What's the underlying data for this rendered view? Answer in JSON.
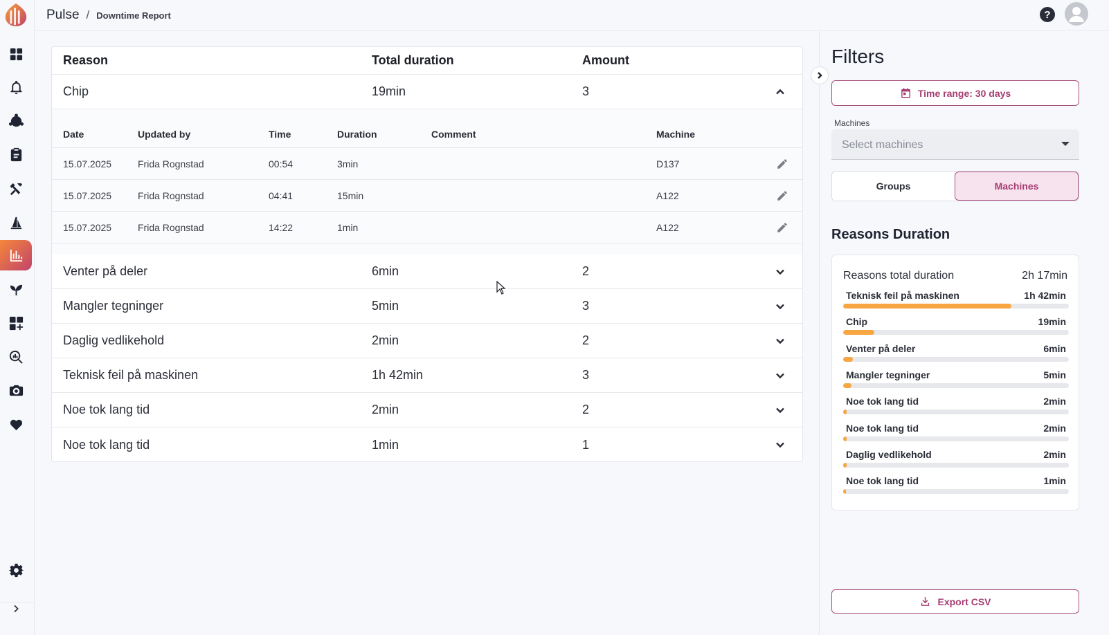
{
  "app": {
    "name": "Pulse",
    "separator": "/",
    "page": "Downtime Report"
  },
  "nav": [
    {
      "icon": "dashboard-icon"
    },
    {
      "icon": "bell-icon"
    },
    {
      "icon": "network-icon"
    },
    {
      "icon": "clipboard-icon"
    },
    {
      "icon": "tools-icon"
    },
    {
      "icon": "flask-icon"
    },
    {
      "icon": "downtime-chart-icon"
    },
    {
      "icon": "sprout-icon"
    },
    {
      "icon": "add-widget-icon"
    },
    {
      "icon": "analytics-search-icon"
    },
    {
      "icon": "camera-icon"
    },
    {
      "icon": "heartbeat-icon"
    }
  ],
  "table": {
    "headers": {
      "reason": "Reason",
      "total": "Total duration",
      "amount": "Amount"
    },
    "expanded": {
      "reason": "Chip",
      "total": "19min",
      "amount": "3",
      "sub_headers": {
        "date": "Date",
        "updated_by": "Updated by",
        "time": "Time",
        "duration": "Duration",
        "comment": "Comment",
        "machine": "Machine"
      },
      "rows": [
        {
          "date": "15.07.2025",
          "updated_by": "Frida Rognstad",
          "time": "00:54",
          "duration": "3min",
          "comment": "",
          "machine": "D137"
        },
        {
          "date": "15.07.2025",
          "updated_by": "Frida Rognstad",
          "time": "04:41",
          "duration": "15min",
          "comment": "",
          "machine": "A122"
        },
        {
          "date": "15.07.2025",
          "updated_by": "Frida Rognstad",
          "time": "14:22",
          "duration": "1min",
          "comment": "",
          "machine": "A122"
        }
      ]
    },
    "rows": [
      {
        "reason": "Venter på deler",
        "total": "6min",
        "amount": "2"
      },
      {
        "reason": "Mangler tegninger",
        "total": "5min",
        "amount": "3"
      },
      {
        "reason": "Daglig vedlikehold",
        "total": "2min",
        "amount": "2"
      },
      {
        "reason": "Teknisk feil på maskinen",
        "total": "1h 42min",
        "amount": "3"
      },
      {
        "reason": "Noe tok lang tid",
        "total": "2min",
        "amount": "2"
      },
      {
        "reason": "Noe tok lang tid",
        "total": "1min",
        "amount": "1"
      }
    ]
  },
  "filters": {
    "title": "Filters",
    "time_range": "Time range: 30 days",
    "machines_label": "Machines",
    "machines_placeholder": "Select machines",
    "toggle": {
      "groups": "Groups",
      "machines": "Machines",
      "selected": "machines"
    },
    "export": "Export CSV"
  },
  "reasons_duration": {
    "title": "Reasons Duration",
    "total_label": "Reasons total duration",
    "total_value": "2h 17min",
    "bar_color": "#f7a641",
    "items": [
      {
        "label": "Teknisk feil på maskinen",
        "value": "1h 42min",
        "fraction": 0.745
      },
      {
        "label": "Chip",
        "value": "19min",
        "fraction": 0.139
      },
      {
        "label": "Venter på deler",
        "value": "6min",
        "fraction": 0.044
      },
      {
        "label": "Mangler tegninger",
        "value": "5min",
        "fraction": 0.036
      },
      {
        "label": "Noe tok lang tid",
        "value": "2min",
        "fraction": 0.015
      },
      {
        "label": "Noe tok lang tid",
        "value": "2min",
        "fraction": 0.015
      },
      {
        "label": "Daglig vedlikehold",
        "value": "2min",
        "fraction": 0.015
      },
      {
        "label": "Noe tok lang tid",
        "value": "1min",
        "fraction": 0.007
      }
    ]
  },
  "colors": {
    "accent": "#a63d72",
    "accent_bg": "#f7e3ee",
    "brand_gradient_start": "#f5873a",
    "brand_gradient_end": "#c1436b"
  }
}
